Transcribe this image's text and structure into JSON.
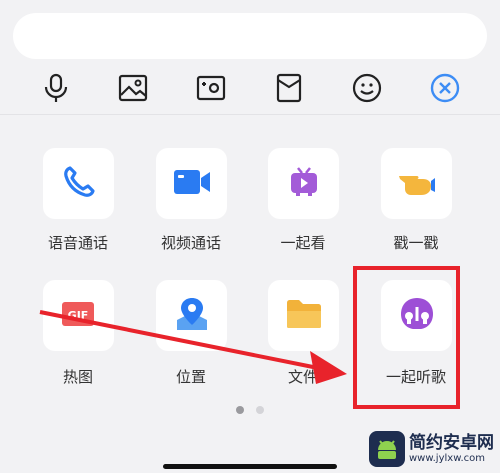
{
  "toolbar": {
    "icons": [
      "microphone-icon",
      "image-icon",
      "camera-icon",
      "red-packet-icon",
      "emoji-icon",
      "close-circle-icon"
    ],
    "close_color": "#3d8df5"
  },
  "actions": [
    {
      "label": "语音通话",
      "icon": "phone-icon"
    },
    {
      "label": "视频通话",
      "icon": "video-icon"
    },
    {
      "label": "一起看",
      "icon": "tv-icon"
    },
    {
      "label": "戳一戳",
      "icon": "poke-hand-icon"
    },
    {
      "label": "热图",
      "icon": "gif-icon"
    },
    {
      "label": "位置",
      "icon": "location-icon"
    },
    {
      "label": "文件",
      "icon": "folder-icon"
    },
    {
      "label": "一起听歌",
      "icon": "music-headphones-icon"
    }
  ],
  "pager": {
    "pages": 2,
    "current": 1
  },
  "watermark": {
    "title": "简约安卓网",
    "url": "www.jylxw.com"
  },
  "annotation_color": "#e8232b"
}
